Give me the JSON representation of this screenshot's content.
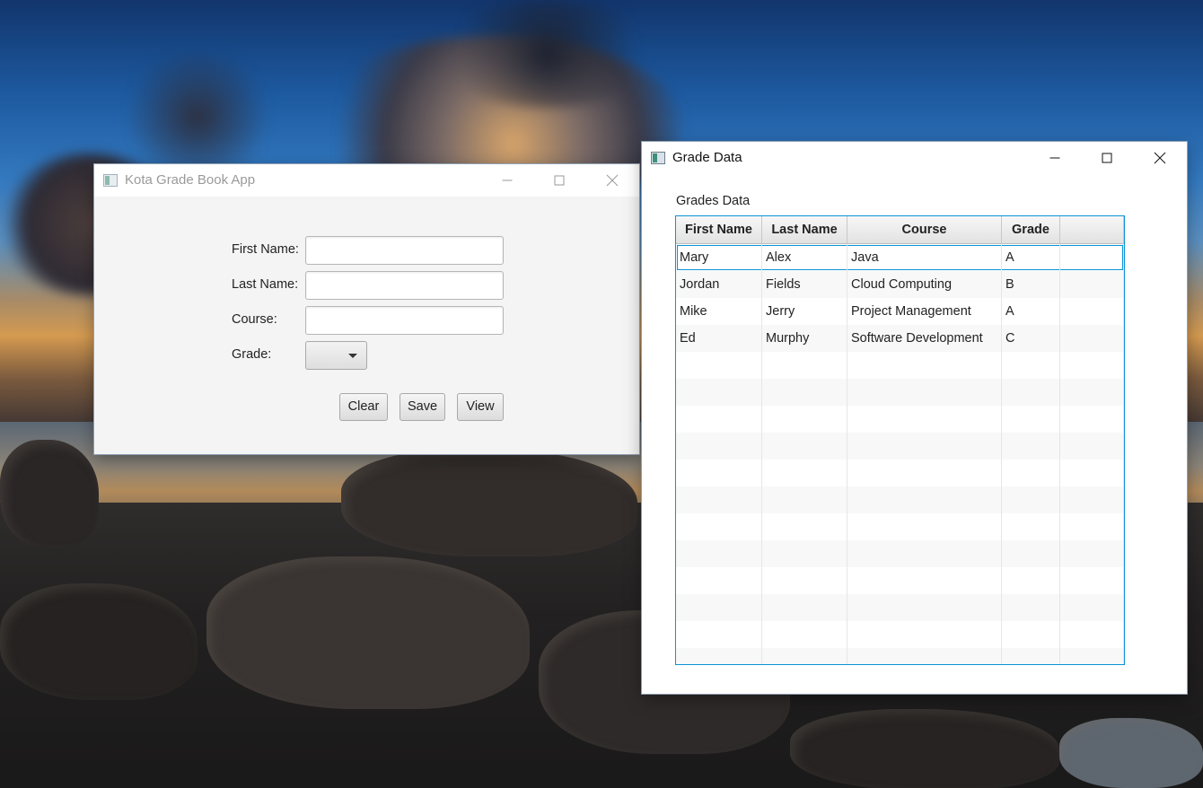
{
  "form_window": {
    "title": "Kota Grade Book App",
    "fields": {
      "first_name": {
        "label": "First Name:",
        "value": ""
      },
      "last_name": {
        "label": "Last Name:",
        "value": ""
      },
      "course": {
        "label": "Course:",
        "value": ""
      },
      "grade": {
        "label": "Grade:",
        "value": ""
      }
    },
    "buttons": {
      "clear": "Clear",
      "save": "Save",
      "view": "View"
    }
  },
  "data_window": {
    "title": "Grade Data",
    "section_label": "Grades Data",
    "table": {
      "columns": [
        "First Name",
        "Last Name",
        "Course",
        "Grade",
        ""
      ],
      "rows": [
        [
          "Mary",
          "Alex",
          "Java",
          "A",
          ""
        ],
        [
          "Jordan",
          "Fields",
          "Cloud Computing",
          "B",
          ""
        ],
        [
          "Mike",
          "Jerry",
          "Project Management",
          "A",
          ""
        ],
        [
          "Ed",
          "Murphy",
          "Software Development",
          "C",
          ""
        ]
      ],
      "focused_row_index": 0
    }
  },
  "colors": {
    "focus_blue": "#0c93d6",
    "window_bg": "#f4f4f4"
  },
  "icons": {
    "window_icon": "java-app-icon",
    "minimize": "minimize-icon",
    "maximize": "maximize-icon",
    "close": "close-icon",
    "combo_arrow": "chevron-down-icon"
  }
}
